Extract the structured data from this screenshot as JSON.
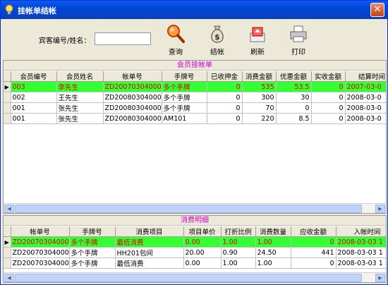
{
  "window": {
    "title": "挂帐单结帐",
    "close_glyph": "✕"
  },
  "toolbar": {
    "search_label": "宾客编号/姓名：",
    "search_value": "",
    "buttons": [
      {
        "label": "查询",
        "icon": "magnifier-icon"
      },
      {
        "label": "结帐",
        "icon": "money-bag-icon"
      },
      {
        "label": "刷新",
        "icon": "refresh-icon"
      },
      {
        "label": "打印",
        "icon": "printer-icon"
      }
    ]
  },
  "bills": {
    "title": "会员挂帐单",
    "columns": [
      "会员编号",
      "会员姓名",
      "帐单号",
      "手牌号",
      "已收押金",
      "消费金额",
      "优惠金额",
      "实收金额",
      "结算时间"
    ],
    "rows": [
      {
        "selected": true,
        "cells": [
          "003",
          "李先生",
          "ZD200703040002",
          "多个手牌",
          "0",
          "535",
          "53.5",
          "0",
          "2007-03-0"
        ]
      },
      {
        "selected": false,
        "cells": [
          "002",
          "王先生",
          "ZD200803040004",
          "多个手牌",
          "0",
          "300",
          "30",
          "0",
          "2008-03-0"
        ]
      },
      {
        "selected": false,
        "cells": [
          "001",
          "张先生",
          "ZD200803040005",
          "多个手牌",
          "0",
          "70",
          "0",
          "0",
          "2008-03-0"
        ]
      },
      {
        "selected": false,
        "cells": [
          "001",
          "张先生",
          "ZD200803040006",
          "AM101",
          "0",
          "220",
          "8.5",
          "0",
          "2008-03-0"
        ]
      }
    ]
  },
  "details": {
    "title": "消费明细",
    "columns": [
      "帐单号",
      "手牌号",
      "消费项目",
      "项目单价",
      "打折比例",
      "消费数量",
      "应收金额",
      "入帐时间"
    ],
    "rows": [
      {
        "selected": true,
        "cells": [
          "ZD200703040002",
          "多个手牌",
          "最低消费",
          "0.00",
          "1.00",
          "1.00",
          "0",
          "2008-03-03 1"
        ]
      },
      {
        "selected": false,
        "cells": [
          "ZD200703040002",
          "多个手牌",
          "HH201包间",
          "20.00",
          "0.90",
          "24.50",
          "441",
          "2008-03-03 1"
        ]
      },
      {
        "selected": false,
        "cells": [
          "ZD200703040002",
          "多个手牌",
          "最低消费",
          "0.00",
          "1.00",
          "1.00",
          "0",
          "2008-03-03 1"
        ]
      }
    ]
  }
}
